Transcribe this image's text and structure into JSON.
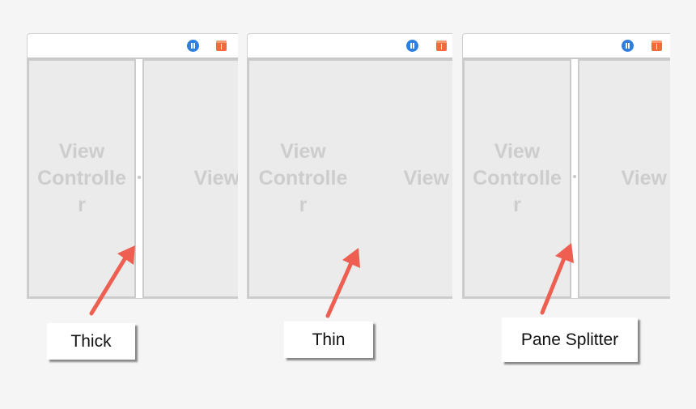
{
  "panels": [
    {
      "variant": "thick",
      "left_pane_label": "View Controller",
      "right_pane_label": "View",
      "icons": [
        "pause-icon",
        "cube-icon"
      ],
      "callout": "Thick"
    },
    {
      "variant": "thin",
      "left_pane_label": "View Controller",
      "right_pane_label": "View",
      "icons": [
        "pause-icon",
        "cube-icon"
      ],
      "callout": "Thin"
    },
    {
      "variant": "pane-splitter",
      "left_pane_label": "View Controller",
      "right_pane_label": "View",
      "icons": [
        "pause-icon",
        "cube-icon"
      ],
      "callout": "Pane Splitter"
    }
  ],
  "label_lines": {
    "left": [
      "View",
      "Controlle",
      "r"
    ],
    "right": "View"
  },
  "colors": {
    "arrow": "#ee5f52",
    "pause_icon": "#2f7fe0",
    "cube_icon": "#f26b3a",
    "pane_bg": "#ebebeb",
    "pane_text": "#cdcdcd"
  }
}
